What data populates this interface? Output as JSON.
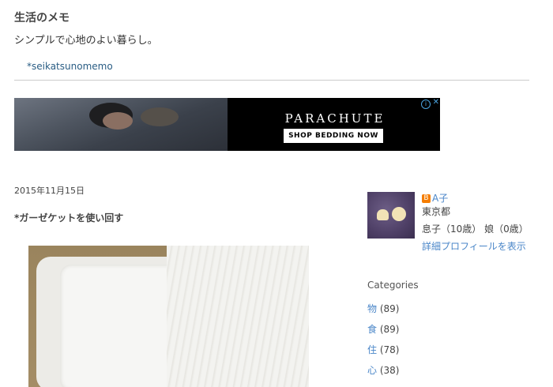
{
  "header": {
    "title": "生活のメモ",
    "description": "シンプルで心地のよい暮らし。",
    "link": "*seikatsunomemo"
  },
  "ad": {
    "brand": "PARACHUTE",
    "cta": "SHOP BEDDING NOW",
    "info_icon": "info-icon",
    "close_icon": "close-icon"
  },
  "post": {
    "date": "2015年11月15日",
    "title": "*ガーゼケットを使い回す"
  },
  "profile": {
    "name": "A子",
    "location": "東京都",
    "about": "息子（10歳） 娘（0歳）",
    "link": "詳細プロフィールを表示"
  },
  "categories": {
    "title": "Categories",
    "items": [
      {
        "label": "物",
        "count": "(89)"
      },
      {
        "label": "食",
        "count": "(89)"
      },
      {
        "label": "住",
        "count": "(78)"
      },
      {
        "label": "心",
        "count": "(38)"
      }
    ]
  }
}
